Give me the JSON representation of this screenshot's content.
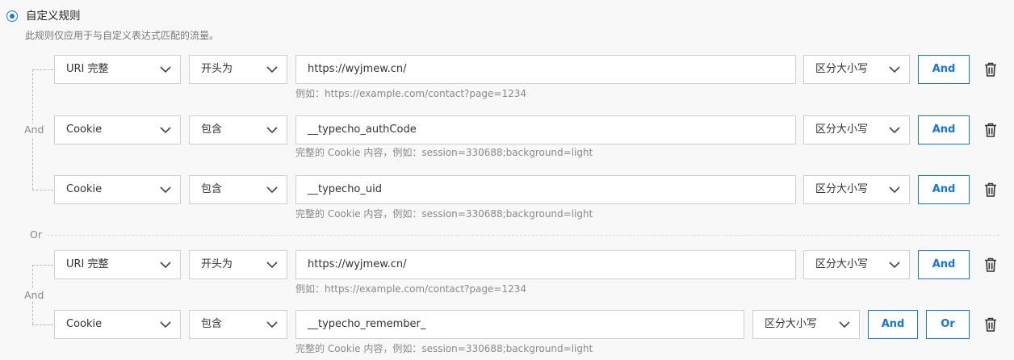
{
  "rule_type": {
    "label": "自定义规则",
    "description": "此规则仅应用于与自定义表达式匹配的流量。",
    "selected": true
  },
  "groups": [
    {
      "join_label": "And",
      "rows": [
        {
          "field": "URI 完整",
          "operator": "开头为",
          "value": "https://wyjmew.cn/",
          "case": "区分大小写",
          "hint": "例如：https://example.com/contact?page=1234",
          "buttons": [
            "And"
          ]
        },
        {
          "field": "Cookie",
          "operator": "包含",
          "value": "__typecho_authCode",
          "case": "区分大小写",
          "hint": "完整的 Cookie 内容，例如：session=330688;background=light",
          "buttons": [
            "And"
          ]
        },
        {
          "field": "Cookie",
          "operator": "包含",
          "value": "__typecho_uid",
          "case": "区分大小写",
          "hint": "完整的 Cookie 内容，例如：session=330688;background=light",
          "buttons": [
            "And"
          ]
        }
      ]
    },
    {
      "join_label": "And",
      "rows": [
        {
          "field": "URI 完整",
          "operator": "开头为",
          "value": "https://wyjmew.cn/",
          "case": "区分大小写",
          "hint": "例如：https://example.com/contact?page=1234",
          "buttons": [
            "And"
          ]
        },
        {
          "field": "Cookie",
          "operator": "包含",
          "value": "__typecho_remember_",
          "case": "区分大小写",
          "hint": "完整的 Cookie 内容，例如：session=330688;background=light",
          "buttons": [
            "And",
            "Or"
          ]
        }
      ]
    }
  ],
  "group_separator": "Or",
  "colors": {
    "accent": "#1676e0",
    "border": "#cfcfcf",
    "hint": "#8a8a8a",
    "background": "#f8f8f8"
  },
  "icons": {
    "chevron": "chevron-down-icon",
    "delete": "trash-icon",
    "radio": "radio-selected-icon"
  }
}
